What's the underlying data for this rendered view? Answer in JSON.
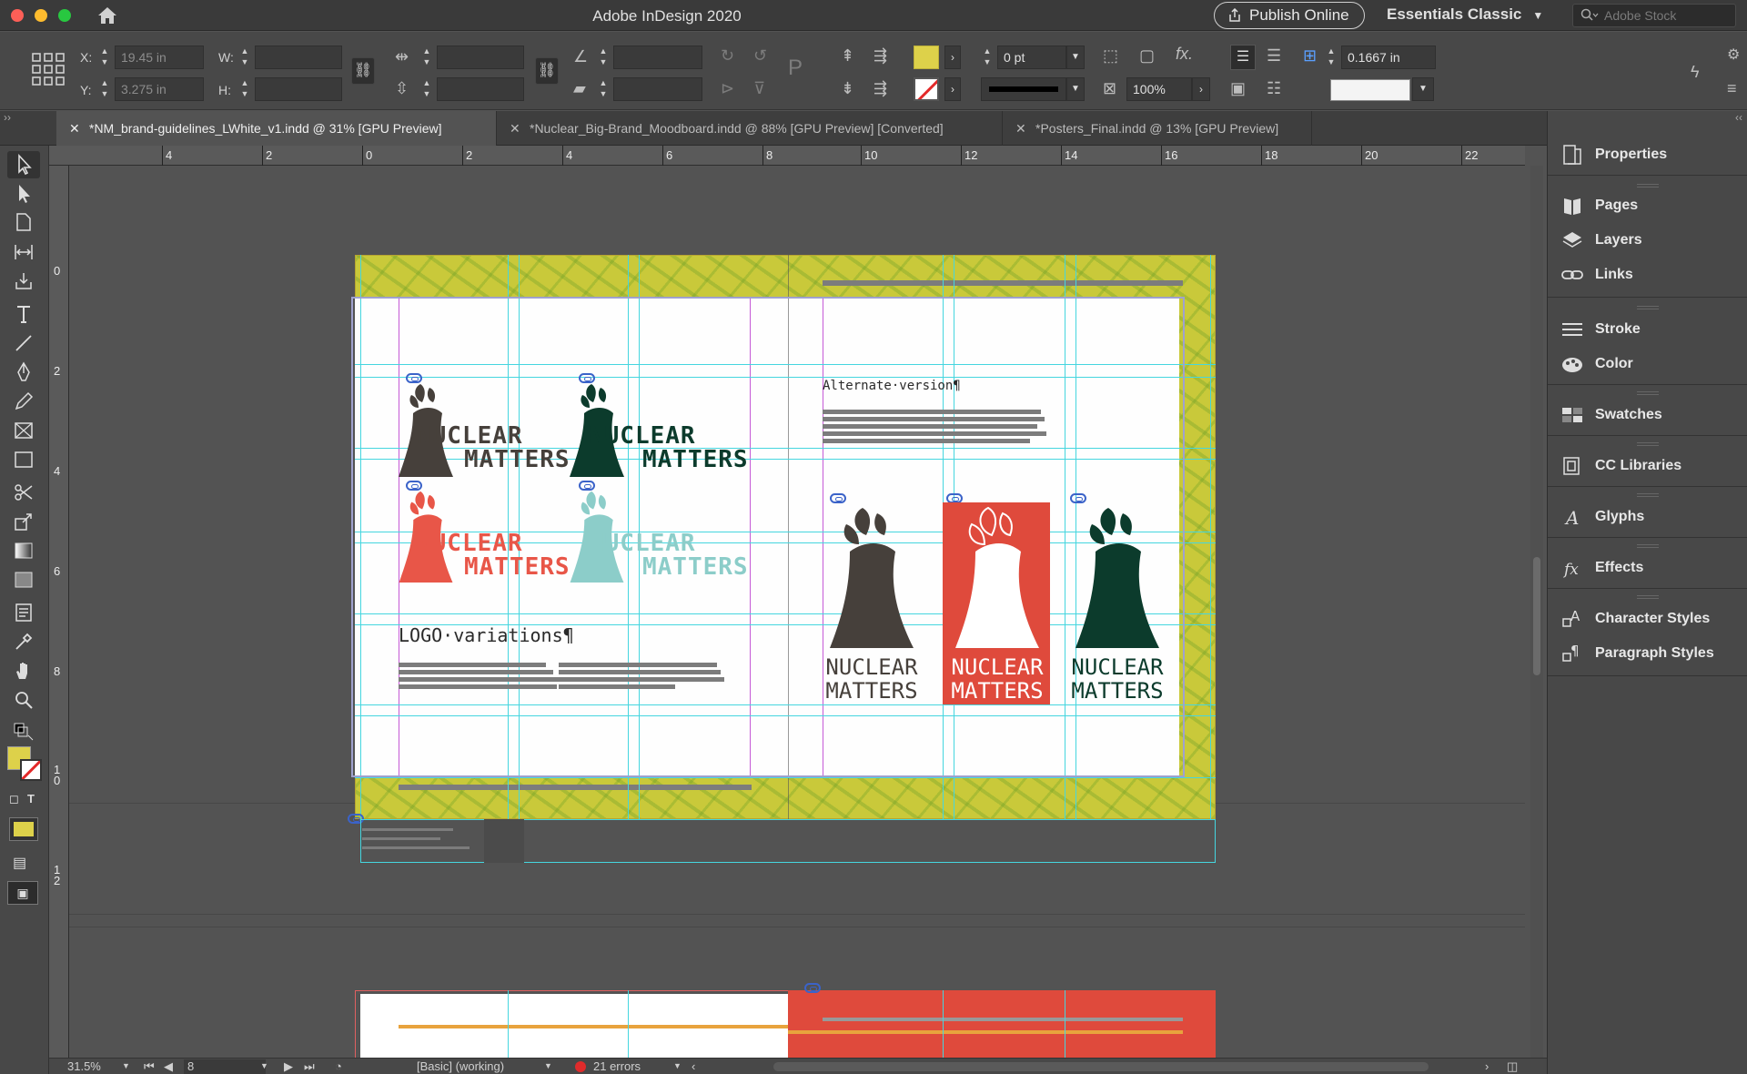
{
  "app": {
    "title": "Adobe InDesign 2020",
    "publish_label": "Publish Online",
    "workspace": "Essentials Classic",
    "stock_placeholder": "Adobe Stock"
  },
  "control": {
    "x_label": "X:",
    "x_value": "19.45 in",
    "y_label": "Y:",
    "y_value": "3.275 in",
    "w_label": "W:",
    "h_label": "H:",
    "stroke_weight": "0 pt",
    "opacity": "100%",
    "gutter": "0.1667 in",
    "fill_color": "#ddd14a"
  },
  "tabs": [
    {
      "label": "*NM_brand-guidelines_LWhite_v1.indd @ 31% [GPU Preview]"
    },
    {
      "label": "*Nuclear_Big-Brand_Moodboard.indd @ 88% [GPU Preview] [Converted]"
    },
    {
      "label": "*Posters_Final.indd @ 13% [GPU Preview]"
    }
  ],
  "ruler_h": [
    "4",
    "2",
    "0",
    "2",
    "4",
    "6",
    "8",
    "10",
    "12",
    "14",
    "16",
    "18",
    "20",
    "22"
  ],
  "ruler_v": [
    "0",
    "2",
    "4",
    "6",
    "8",
    "1\n0",
    "1\n2",
    "0"
  ],
  "document": {
    "logo_top": "NUCLEAR",
    "logo_bottom": "MATTERS",
    "logo_prefix": "NU",
    "logo_suffix": "CLEAR",
    "logo_variations_label": "LOGO·variations¶",
    "alternate_label": "Alternate·version¶",
    "colors": {
      "charcoal": "#46403b",
      "dark_green": "#0c3b2c",
      "coral": "#e85648",
      "aqua": "#8ccdc9",
      "red_bg": "#df4a3c",
      "bleed_yellow": "#c9c93a"
    }
  },
  "panels": [
    {
      "label": "Properties",
      "icon": "properties-icon"
    },
    {
      "label": "Pages",
      "icon": "pages-icon"
    },
    {
      "label": "Layers",
      "icon": "layers-icon"
    },
    {
      "label": "Links",
      "icon": "links-icon"
    },
    {
      "label": "Stroke",
      "icon": "stroke-icon"
    },
    {
      "label": "Color",
      "icon": "color-icon"
    },
    {
      "label": "Swatches",
      "icon": "swatches-icon"
    },
    {
      "label": "CC Libraries",
      "icon": "cc-libraries-icon"
    },
    {
      "label": "Glyphs",
      "icon": "glyphs-icon"
    },
    {
      "label": "Effects",
      "icon": "effects-icon"
    },
    {
      "label": "Character Styles",
      "icon": "character-styles-icon"
    },
    {
      "label": "Paragraph Styles",
      "icon": "paragraph-styles-icon"
    }
  ],
  "status": {
    "zoom": "31.5%",
    "page": "8",
    "style": "[Basic] (working)",
    "errors": "21 errors"
  }
}
